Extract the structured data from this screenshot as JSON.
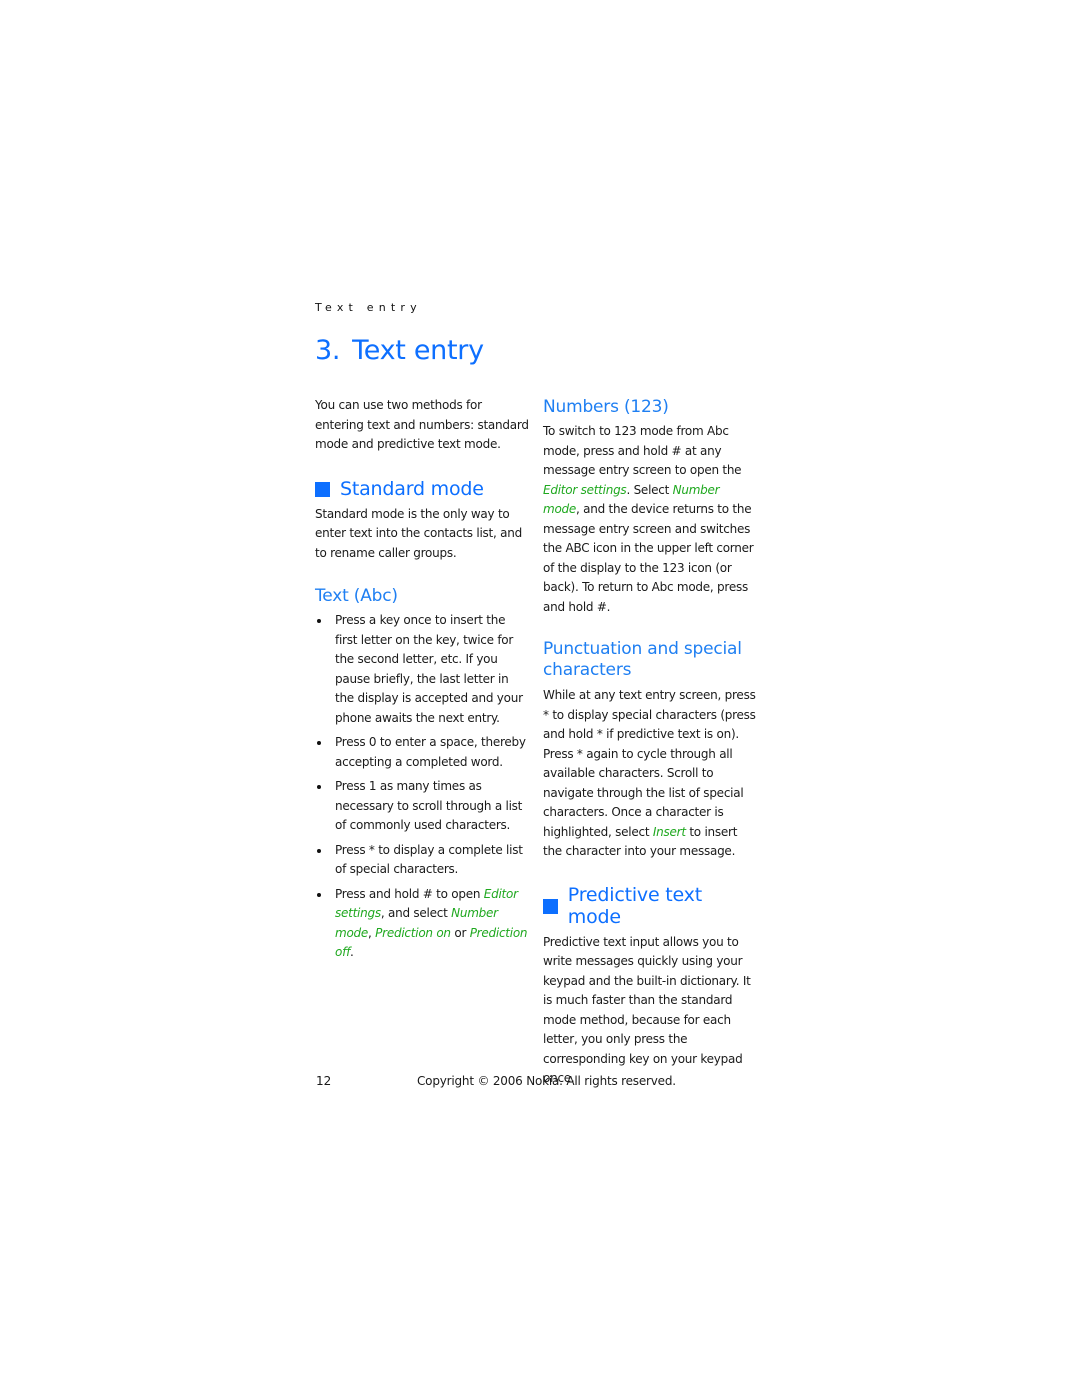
{
  "running_head": "Text entry",
  "chapter": {
    "number": "3.",
    "title": "Text entry"
  },
  "left_column": {
    "intro": "You can use two methods for entering text and numbers: standard mode and predictive text mode.",
    "standard_mode": {
      "heading": "Standard mode",
      "body": "Standard mode is the only way to enter text into the contacts list, and to rename caller groups."
    },
    "text_abc": {
      "heading": "Text (Abc)",
      "bullets": [
        {
          "text": "Press a key once to insert the first letter on the key, twice for the second letter, etc. If you pause briefly, the last letter in the display is accepted and your phone awaits the next entry."
        },
        {
          "text": "Press 0 to enter a space, thereby accepting a completed word."
        },
        {
          "text": "Press 1 as many times as necessary to scroll through a list of commonly used characters."
        },
        {
          "text": "Press * to display a complete list of special characters."
        },
        {
          "t1": "Press and hold # to open ",
          "e1": "Editor settings",
          "t2": ", and select ",
          "e2": "Number mode",
          "t3": ", ",
          "e3": "Prediction on",
          "t4": " or ",
          "e4": "Prediction off",
          "t5": "."
        }
      ]
    }
  },
  "right_column": {
    "numbers": {
      "heading": "Numbers (123)",
      "t1": "To switch to 123 mode from Abc mode, press and hold # at any message entry screen to open the ",
      "e1": "Editor settings",
      "t2": ". Select ",
      "e2": "Number mode",
      "t3": ", and the device returns to the message entry screen and switches the ABC icon in the upper left corner of the display to the 123 icon (or back). To return to Abc mode, press and hold #."
    },
    "punctuation": {
      "heading": "Punctuation and special characters",
      "t1": "While at any text entry screen, press * to display special characters (press and hold * if predictive text is on). Press * again to cycle through all available characters. Scroll to navigate through the list of special characters. Once a character is highlighted, select ",
      "e1": "Insert",
      "t2": " to insert the character into your message."
    },
    "predictive": {
      "heading": "Predictive text mode",
      "body": "Predictive text input allows you to write messages quickly using your keypad and the built-in dictionary. It is much faster than the standard mode method, because for each letter, you only press the corresponding key on your keypad once."
    }
  },
  "footer": {
    "page_number": "12",
    "copyright": "Copyright © 2006 Nokia. All rights reserved."
  },
  "colors": {
    "heading_blue": "#0d6fff",
    "subheading_blue": "#1f7ff2",
    "emphasis_green": "#1fa81f",
    "body_text": "#1a1a1a"
  }
}
